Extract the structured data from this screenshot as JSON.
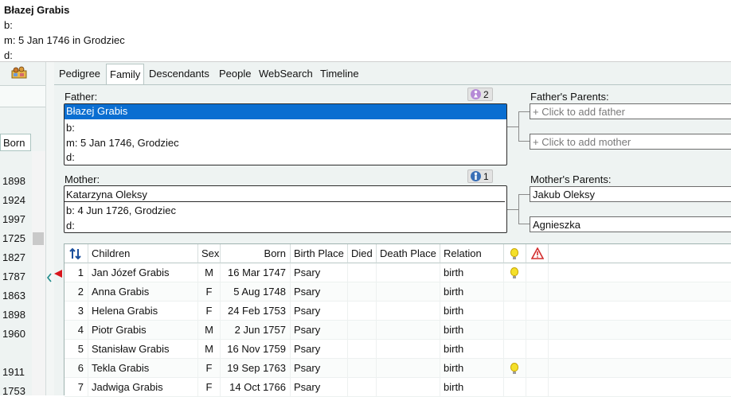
{
  "selected_person": {
    "name": "Błazej Grabis",
    "born": "b:",
    "married": "m: 5 Jan 1746 in Grodziec",
    "died": "d:"
  },
  "left_panel": {
    "born_header": "Born",
    "years": [
      "1898",
      "1924",
      "1997",
      "1725",
      "1827",
      "1787",
      "1863",
      "1898",
      "1960",
      "1911",
      "1753"
    ]
  },
  "tabs": [
    "Pedigree",
    "Family",
    "Descendants",
    "People",
    "WebSearch",
    "Timeline"
  ],
  "active_tab": "Family",
  "father": {
    "label": "Father:",
    "name": "Błazej Grabis",
    "born": "b:",
    "married": "m: 5 Jan 1746, Grodziec",
    "died": "d:",
    "spouse_count": "2"
  },
  "mother": {
    "label": "Mother:",
    "name": "Katarzyna Oleksy",
    "born": "b: 4 Jun 1726, Grodziec",
    "died": "d:",
    "spouse_count": "1"
  },
  "fathers_parents": {
    "label": "Father's Parents:",
    "father_placeholder": "+ Click to add father",
    "mother_placeholder": "+ Click to add mother"
  },
  "mothers_parents": {
    "label": "Mother's Parents:",
    "father": "Jakub Oleksy",
    "mother": "Agnieszka"
  },
  "children_grid": {
    "columns": [
      "Children",
      "Sex",
      "Born",
      "Birth Place",
      "Died",
      "Death Place",
      "Relation"
    ],
    "rows": [
      {
        "num": "1",
        "name": "Jan Józef Grabis",
        "sex": "M",
        "born": "16 Mar 1747",
        "birth_place": "Psary",
        "died": "",
        "death_place": "",
        "relation": "birth",
        "hint": true
      },
      {
        "num": "2",
        "name": "Anna Grabis",
        "sex": "F",
        "born": "5 Aug 1748",
        "birth_place": "Psary",
        "died": "",
        "death_place": "",
        "relation": "birth",
        "hint": false
      },
      {
        "num": "3",
        "name": "Helena Grabis",
        "sex": "F",
        "born": "24 Feb 1753",
        "birth_place": "Psary",
        "died": "",
        "death_place": "",
        "relation": "birth",
        "hint": false
      },
      {
        "num": "4",
        "name": "Piotr Grabis",
        "sex": "M",
        "born": "2 Jun 1757",
        "birth_place": "Psary",
        "died": "",
        "death_place": "",
        "relation": "birth",
        "hint": false
      },
      {
        "num": "5",
        "name": "Stanisław Grabis",
        "sex": "M",
        "born": "16 Nov 1759",
        "birth_place": "Psary",
        "died": "",
        "death_place": "",
        "relation": "birth",
        "hint": false
      },
      {
        "num": "6",
        "name": "Tekla Grabis",
        "sex": "F",
        "born": "19 Sep 1763",
        "birth_place": "Psary",
        "died": "",
        "death_place": "",
        "relation": "birth",
        "hint": true
      },
      {
        "num": "7",
        "name": "Jadwiga Grabis",
        "sex": "F",
        "born": "14 Oct 1766",
        "birth_place": "Psary",
        "died": "",
        "death_place": "",
        "relation": "birth",
        "hint": false
      }
    ]
  },
  "colors": {
    "selection": "#0a6ed1",
    "panel_bg": "#eef3f2",
    "male_icon": "#3a6fb6",
    "female_icon": "#b58ad6",
    "warning": "#d32f2f",
    "hint_bulb": "#f4e02a"
  }
}
